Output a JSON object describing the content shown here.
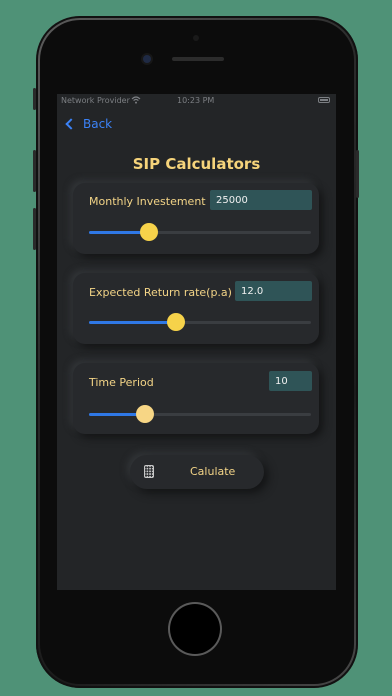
{
  "status_bar": {
    "carrier": "Network Provider",
    "time": "10:23 PM"
  },
  "nav": {
    "back_label": "Back"
  },
  "title": "SIP Calculators",
  "cards": [
    {
      "label": "Monthly Investement",
      "value": "25000",
      "slider_fraction": 0.27,
      "thumb_color": "#f6d24a"
    },
    {
      "label": "Expected Return rate(p.a)",
      "value": "12.0",
      "slider_fraction": 0.39,
      "thumb_color": "#f6d24a"
    },
    {
      "label": "Time Period",
      "value": "10",
      "slider_fraction": 0.25,
      "thumb_color": "#f7d685"
    }
  ],
  "calculate_button": {
    "label": "Calulate"
  },
  "colors": {
    "background": "#4f9277",
    "screen": "#232527",
    "accent_text": "#f3d487",
    "link": "#3b82f6",
    "slider_fill": "#2f78e6",
    "input_bg": "#2f5457"
  }
}
